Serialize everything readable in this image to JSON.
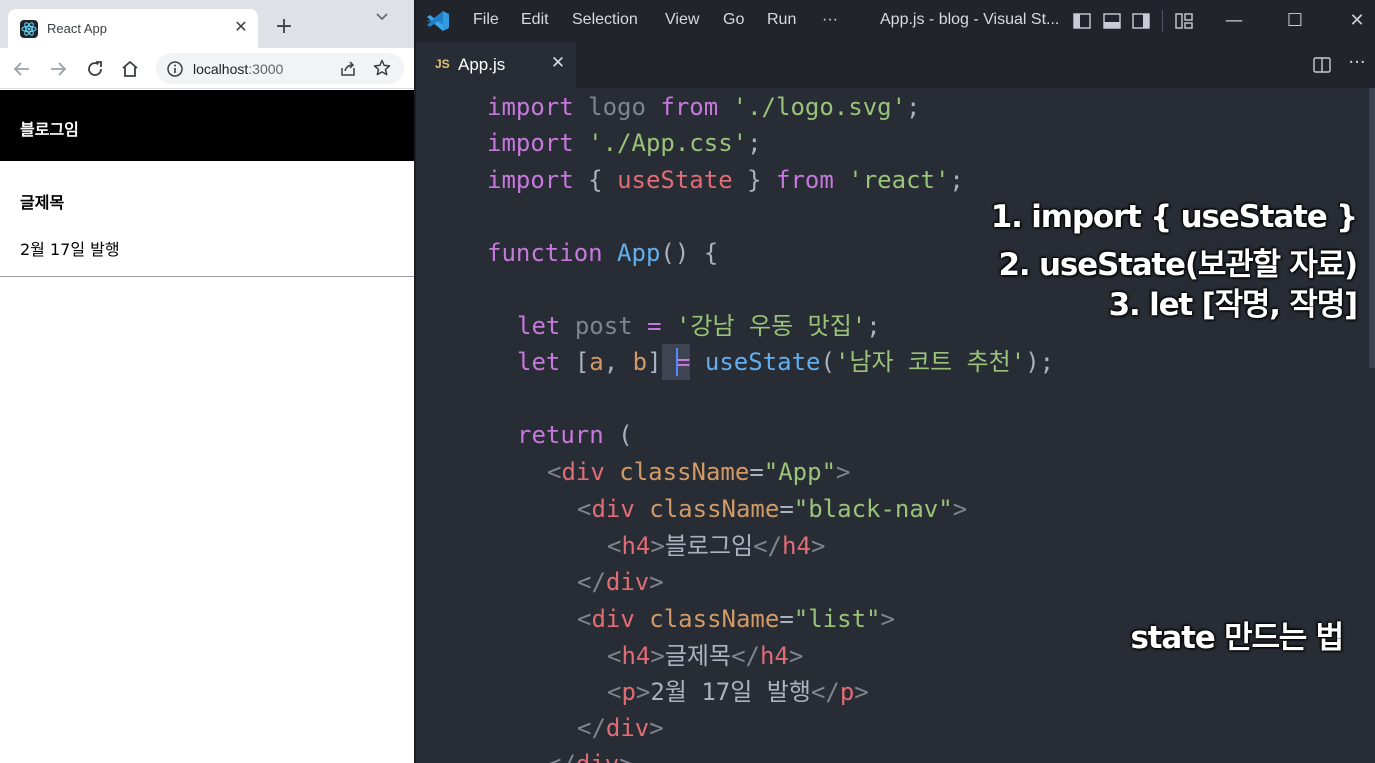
{
  "browser": {
    "tab": {
      "title": "React App",
      "close": "✕"
    },
    "new_tab": "+",
    "address": {
      "host": "localhost",
      "port": ":3000"
    },
    "page": {
      "nav_title": "블로그임",
      "post_title": "글제목",
      "post_date": "2월 17일 발행"
    }
  },
  "vscode": {
    "menu": [
      "File",
      "Edit",
      "Selection",
      "View",
      "Go",
      "Run",
      "···"
    ],
    "window_title": "App.js - blog - Visual St...",
    "tab": {
      "badge": "JS",
      "name": "App.js",
      "close": "✕"
    },
    "window_controls": {
      "minimize": "—",
      "maximize": "☐",
      "close": "✕"
    },
    "more": "···",
    "code": {
      "l1": {
        "k1": "import",
        "v": "logo",
        "k2": "from",
        "s": "'./logo.svg'",
        "p": ";"
      },
      "l2": {
        "k1": "import",
        "s": "'./App.css'",
        "p": ";"
      },
      "l3": {
        "k1": "import",
        "o": "{",
        "v": "useState",
        "c": "}",
        "k2": "from",
        "s": "'react'",
        "p": ";"
      },
      "l5": {
        "k1": "function",
        "f": "App",
        "p": "() {"
      },
      "l7": {
        "k1": "let",
        "v": "post",
        "eq": "=",
        "s": "'강남 우동 맛집'",
        "p": ";"
      },
      "l8": {
        "k1": "let",
        "o": "[",
        "a": "a",
        "comma": ",",
        "b": "b",
        "c": "]",
        "eq": "=",
        "f": "useState",
        "po": "(",
        "s": "'남자 코트 추천'",
        "pc": ");"
      },
      "l10": {
        "k1": "return",
        "p": "("
      },
      "l11": {
        "lt": "<",
        "t": "div",
        "a": "className",
        "eq": "=",
        "s": "\"App\"",
        "gt": ">"
      },
      "l12": {
        "lt": "<",
        "t": "div",
        "a": "className",
        "eq": "=",
        "s": "\"black-nav\"",
        "gt": ">"
      },
      "l13": {
        "lt": "<",
        "t": "h4",
        "gt": ">",
        "txt": "블로그임",
        "lt2": "</",
        "t2": "h4",
        "gt2": ">"
      },
      "l14": {
        "lt": "</",
        "t": "div",
        "gt": ">"
      },
      "l15": {
        "lt": "<",
        "t": "div",
        "a": "className",
        "eq": "=",
        "s": "\"list\"",
        "gt": ">"
      },
      "l16": {
        "lt": "<",
        "t": "h4",
        "gt": ">",
        "txt": "글제목",
        "lt2": "</",
        "t2": "h4",
        "gt2": ">"
      },
      "l17": {
        "lt": "<",
        "t": "p",
        "gt": ">",
        "txt": "2월 17일 발행",
        "lt2": "</",
        "t2": "p",
        "gt2": ">"
      },
      "l18": {
        "lt": "</",
        "t": "div",
        "gt": ">"
      },
      "l19": {
        "lt": "</",
        "t": "div",
        "gt": ">"
      }
    }
  },
  "overlay": {
    "steps": [
      "1. import { useState }",
      "2. useState(보관할 자료)",
      "3. let [작명, 작명]"
    ],
    "caption": "state 만드는 법"
  },
  "colors": {
    "keyword": "#c678dd",
    "string": "#98c379",
    "function": "#61afef",
    "tag": "#e06c75",
    "attribute": "#d19a66",
    "editor_bg": "#282c34"
  }
}
